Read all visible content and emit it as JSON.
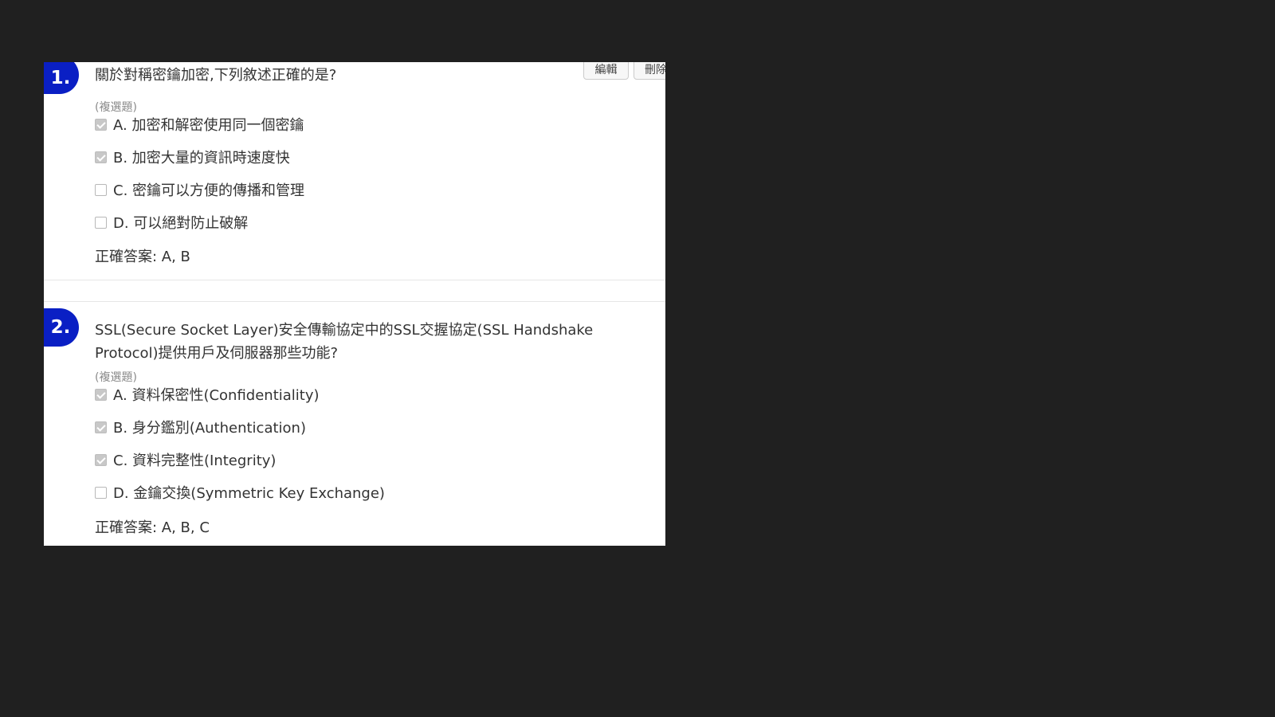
{
  "toolbar": {
    "edit_label": "編輯",
    "delete_label": "刪除"
  },
  "questions": [
    {
      "number": "1.",
      "text": "關於對稱密鑰加密,下列敘述正確的是?",
      "type": "(複選題)",
      "options": [
        {
          "label": "A. 加密和解密使用同一個密鑰",
          "checked": true
        },
        {
          "label": "B. 加密大量的資訊時速度快",
          "checked": true
        },
        {
          "label": "C. 密鑰可以方便的傳播和管理",
          "checked": false
        },
        {
          "label": "D. 可以絕對防止破解",
          "checked": false
        }
      ],
      "answer": "正確答案: A, B"
    },
    {
      "number": "2.",
      "text": "SSL(Secure Socket Layer)安全傳輸協定中的SSL交握協定(SSL Handshake Protocol)提供用戶及伺服器那些功能?",
      "type": "(複選題)",
      "options": [
        {
          "label": "A. 資料保密性(Confidentiality)",
          "checked": true
        },
        {
          "label": "B. 身分鑑別(Authentication)",
          "checked": true
        },
        {
          "label": "C. 資料完整性(Integrity)",
          "checked": true
        },
        {
          "label": "D. 金鑰交換(Symmetric Key Exchange)",
          "checked": false
        }
      ],
      "answer": "正確答案: A, B, C"
    }
  ],
  "colors": {
    "background": "#202020",
    "panel": "#ffffff",
    "badge": "#0a1fc4",
    "text": "#333333",
    "muted": "#8a8a8a"
  }
}
